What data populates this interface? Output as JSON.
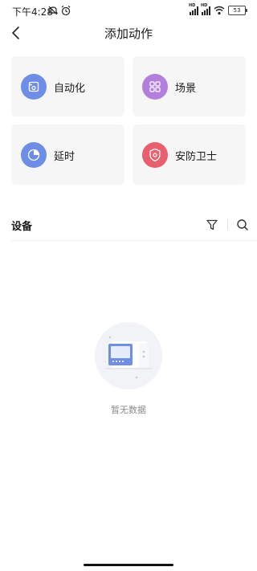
{
  "status_bar": {
    "time": "下午4:28",
    "battery": "53",
    "signal_label": "HD"
  },
  "header": {
    "title": "添加动作"
  },
  "actions": [
    {
      "label": "自动化",
      "icon": "automation-icon",
      "color": "#6d8de6"
    },
    {
      "label": "场景",
      "icon": "scene-grid-icon",
      "color": "#b37fdc"
    },
    {
      "label": "延时",
      "icon": "delay-pie-icon",
      "color": "#6d8de6"
    },
    {
      "label": "安防卫士",
      "icon": "security-shield-icon",
      "color": "#ea5f6e"
    }
  ],
  "devices": {
    "title": "设备",
    "filter_icon": "filter-icon",
    "search_icon": "search-icon"
  },
  "empty_state": {
    "text": "暂无数据",
    "illustration": "empty-device-illustration"
  }
}
